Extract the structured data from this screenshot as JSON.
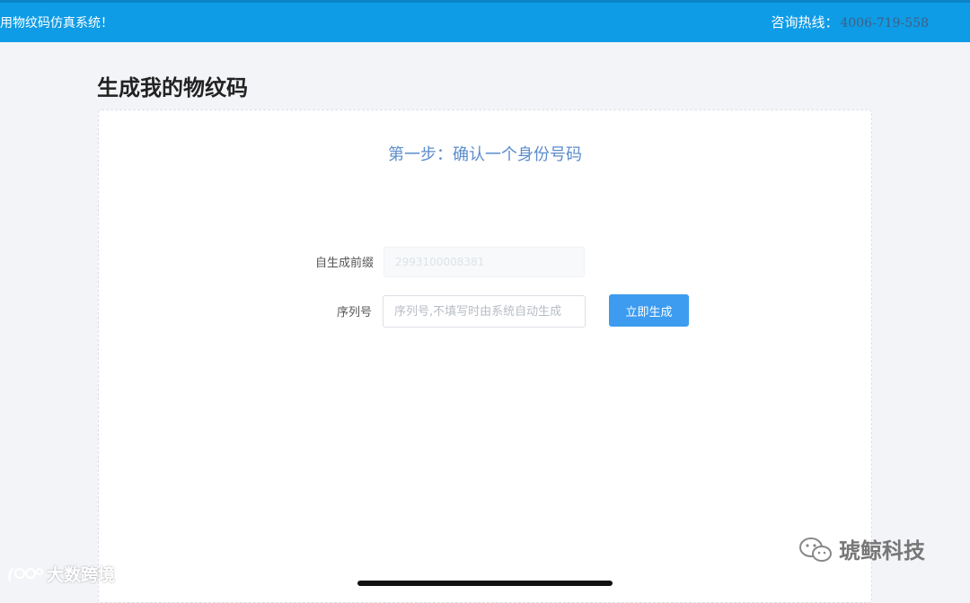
{
  "header": {
    "welcome_text": "用物纹码仿真系统！",
    "hotline_label": "咨询热线：",
    "hotline_number": "4006-719-558"
  },
  "page": {
    "title": "生成我的物纹码"
  },
  "step": {
    "title": "第一步：确认一个身份号码"
  },
  "form": {
    "prefix_label": "自生成前缀",
    "prefix_value": "2993100008381",
    "serial_label": "序列号",
    "serial_placeholder": "序列号,不填写时由系统自动生成",
    "serial_value": "",
    "generate_label": "立即生成"
  },
  "watermarks": {
    "left_text": "大数跨境",
    "right_text": "琥鲸科技"
  },
  "colors": {
    "header_bg": "#0f9ce6",
    "button_bg": "#3d9cf0",
    "step_title": "#5b8ccc"
  }
}
